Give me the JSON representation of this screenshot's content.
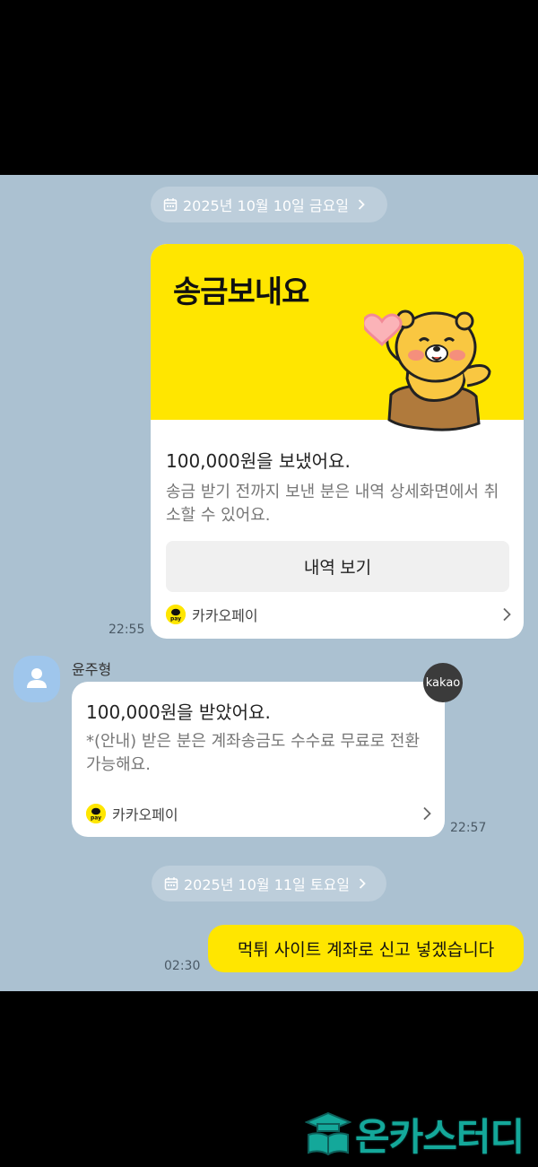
{
  "dates": {
    "first": "2025년 10월 10일 금요일",
    "second": "2025년 10월 11일 토요일"
  },
  "send_card": {
    "title": "송금보내요",
    "amount_text": "100,000원을 보냈어요.",
    "description": "송금 받기 전까지 보낸 분은 내역 상세화면에서 취소할 수 있어요.",
    "button_label": "내역 보기",
    "provider": "카카오페이",
    "time": "22:55"
  },
  "received": {
    "sender_name": "윤주형",
    "badge": "kakao",
    "amount_text": "100,000원을 받았어요.",
    "description": "*(안내) 받은 분은 계좌송금도 수수료 무료로 전환 가능해요.",
    "provider": "카카오페이",
    "time": "22:57"
  },
  "my_message": {
    "text": "먹튀 사이트 계좌로 신고 넣겠습니다",
    "time": "02:30"
  },
  "pay_logo_text": "pay",
  "watermark": {
    "text": "온카스터디"
  },
  "colors": {
    "chat_background": "#abc1d1",
    "kakao_yellow": "#ffe600",
    "watermark_teal": "#14a89a"
  }
}
